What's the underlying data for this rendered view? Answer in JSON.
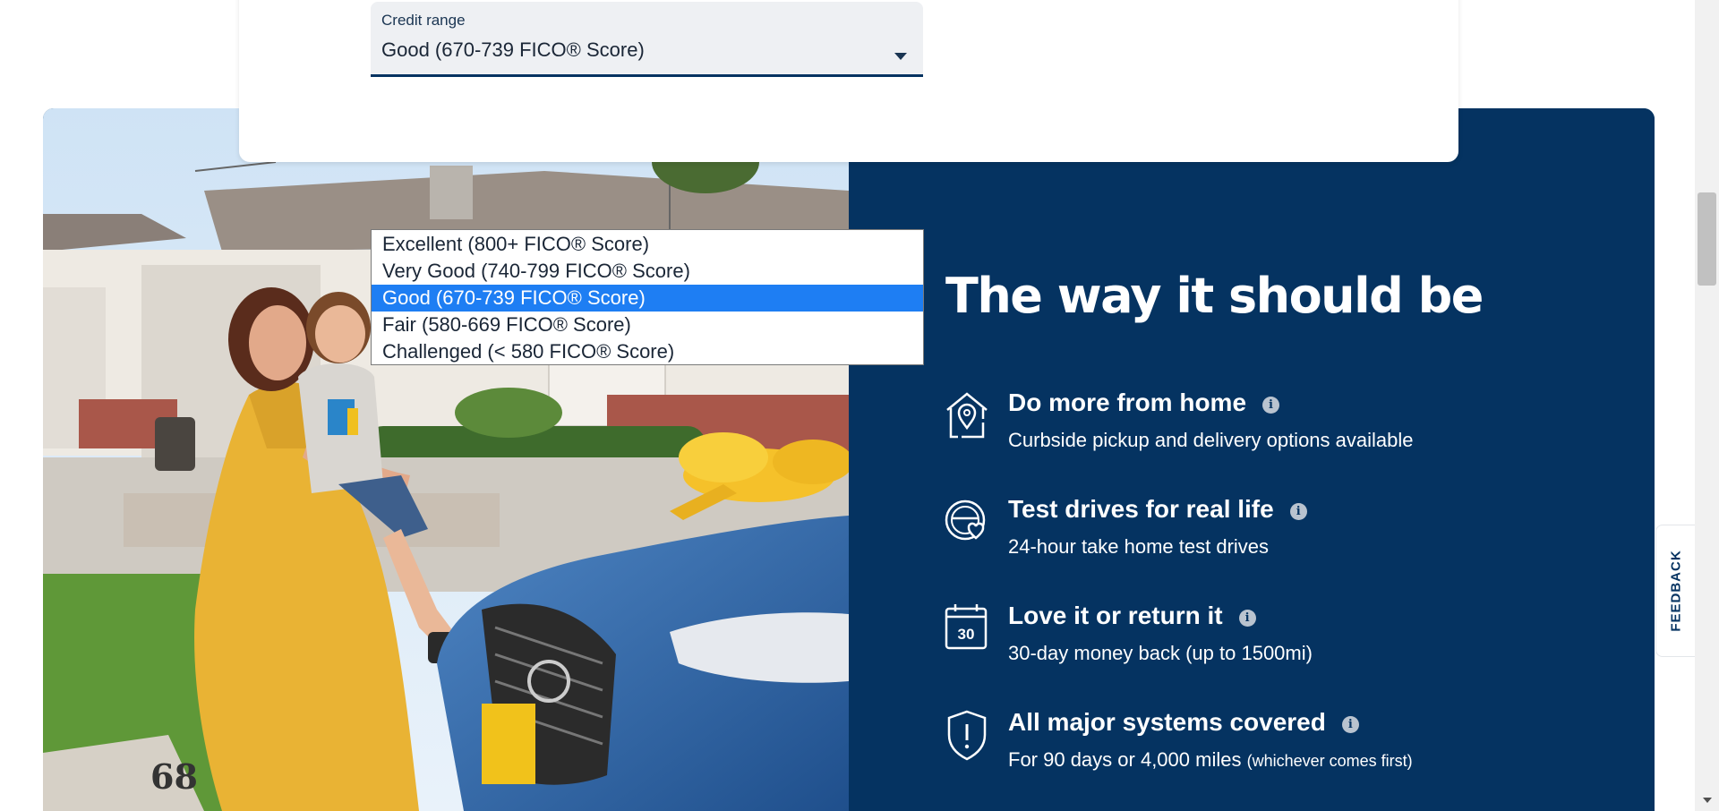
{
  "credit_select": {
    "label": "Credit range",
    "value": "Good (670-739 FICO® Score)",
    "options": [
      {
        "label": "Excellent (800+ FICO® Score)",
        "selected": false
      },
      {
        "label": "Very Good (740-799 FICO® Score)",
        "selected": false
      },
      {
        "label": "Good (670-739 FICO® Score)",
        "selected": true
      },
      {
        "label": "Fair (580-669 FICO® Score)",
        "selected": false
      },
      {
        "label": "Challenged (< 580 FICO® Score)",
        "selected": false
      }
    ]
  },
  "panel": {
    "title": "The way it should be",
    "features": [
      {
        "icon": "home-location-icon",
        "title": "Do more from home",
        "desc": "Curbside pickup and delivery options available",
        "desc_note": ""
      },
      {
        "icon": "steering-wheel-heart-icon",
        "title": "Test drives for real life",
        "desc": "24-hour take home test drives",
        "desc_note": ""
      },
      {
        "icon": "calendar-return-icon",
        "title": "Love it or return it",
        "desc": "30-day money back (up to 1500mi)",
        "desc_note": "",
        "icon_text": "30"
      },
      {
        "icon": "shield-alert-icon",
        "title": "All major systems covered",
        "desc": "For 90 days or 4,000 miles ",
        "desc_note": "(whichever comes first)"
      }
    ],
    "info_glyph": "i"
  },
  "photo": {
    "house_number": "68"
  },
  "feedback": {
    "label": "FEEDBACK"
  },
  "colors": {
    "navy": "#053361",
    "selected_option": "#1e7ef3",
    "select_bg": "#eef0f3"
  }
}
